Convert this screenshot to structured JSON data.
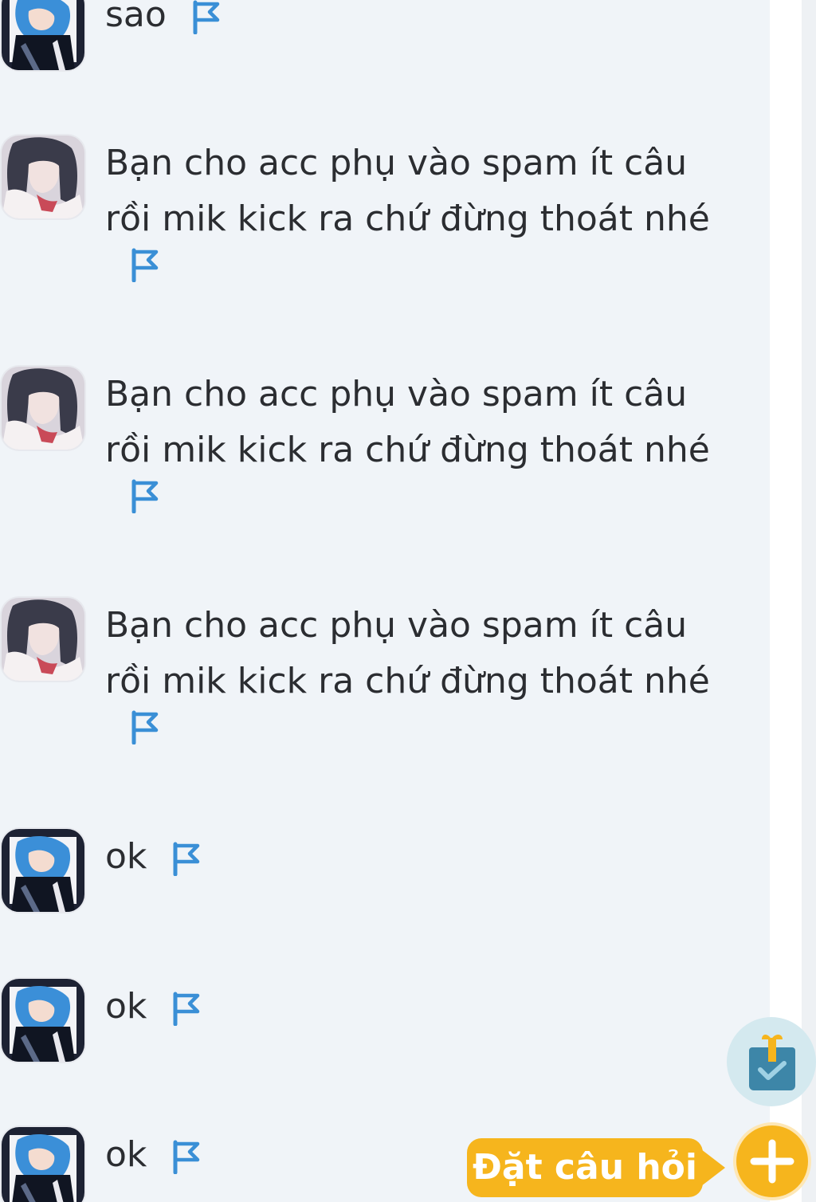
{
  "messages": [
    {
      "text": "sao",
      "avatar": "blue-hair-anime-avatar"
    },
    {
      "text": "Bạn cho acc phụ vào spam ít câu rồi mik kick ra chứ đừng thoát nhé",
      "avatar": "dark-hair-anime-avatar"
    },
    {
      "text": "Bạn cho acc phụ vào spam ít câu rồi mik kick ra chứ đừng thoát nhé",
      "avatar": "dark-hair-anime-avatar"
    },
    {
      "text": "Bạn cho acc phụ vào spam ít câu rồi mik kick ra chứ đừng thoát nhé",
      "avatar": "dark-hair-anime-avatar"
    },
    {
      "text": "ok",
      "avatar": "blue-hair-anime-avatar"
    },
    {
      "text": "ok",
      "avatar": "blue-hair-anime-avatar"
    },
    {
      "text": "ok",
      "avatar": "blue-hair-anime-avatar"
    }
  ],
  "actions": {
    "ask_question_label": "Đặt câu hỏi",
    "gift_icon": "gift-check-icon",
    "plus_icon": "plus-icon",
    "report_icon": "flag-icon"
  },
  "colors": {
    "background": "#f0f4f8",
    "text": "#2b2d31",
    "flag": "#3a8fd6",
    "accent": "#f6b51d",
    "gift_bg": "#d4e9ef"
  }
}
